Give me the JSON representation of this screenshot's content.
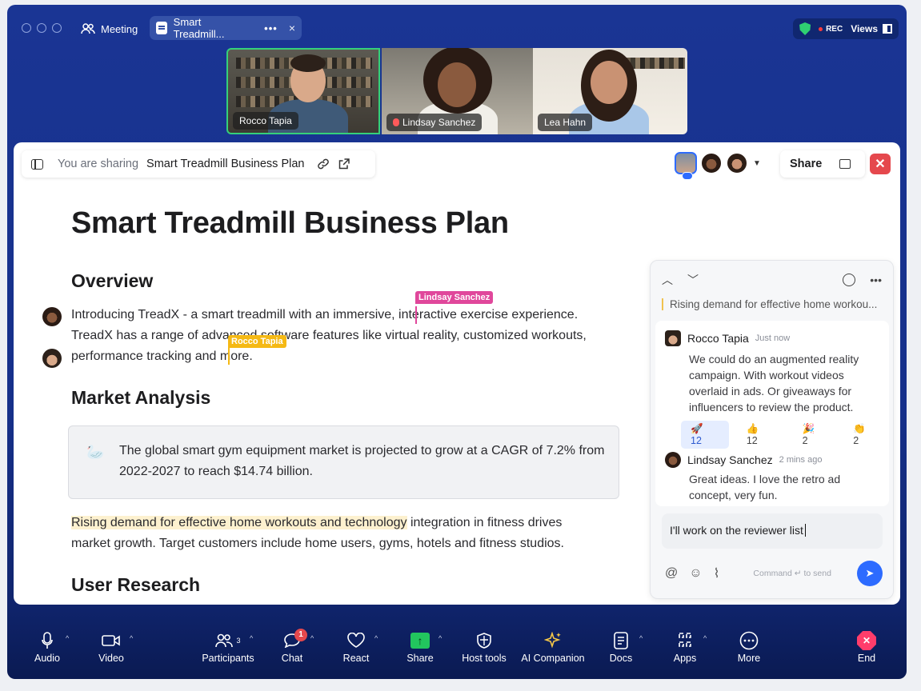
{
  "titlebar": {
    "meeting_label": "Meeting",
    "doc_tab_label": "Smart Treadmill...",
    "doc_tab_more": "•••",
    "doc_tab_close": "×",
    "rec_label": "REC",
    "views_label": "Views"
  },
  "participants_video": [
    {
      "name": "Rocco Tapia",
      "muted": false
    },
    {
      "name": "Lindsay Sanchez",
      "muted": true
    },
    {
      "name": "Lea Hahn",
      "muted": false
    }
  ],
  "sharebar": {
    "prefix": "You are sharing",
    "doc_name": "Smart Treadmill Business Plan"
  },
  "share_button": {
    "label": "Share"
  },
  "document": {
    "title": "Smart Treadmill Business Plan",
    "overview_heading": "Overview",
    "overview_line1": "Introducing TreadX - a smart treadmill with an immersive, interactive exercise experience.",
    "overview_line2": "TreadX has a range of advanced software features like virtual reality, customized workouts,",
    "overview_line3": "performance tracking and more.",
    "market_heading": "Market Analysis",
    "callout_emoji": "🦢",
    "callout_text": "The global smart gym equipment market is projected to grow at a CAGR of 7.2% from 2022-2027 to reach $14.74 billion.",
    "market_highlight": "Rising demand for effective home workouts and technology",
    "market_rest1": " integration in fitness drives",
    "market_line2": "market growth. Target customers include home users, gyms, hotels and fitness studios.",
    "research_heading": "User Research"
  },
  "cursors": {
    "lindsay": "Lindsay Sanchez",
    "rocco": "Rocco Tapia",
    "lindsay_color": "#e0479b",
    "rocco_color": "#f5b914"
  },
  "comments": {
    "quote": "Rising demand for effective home workou...",
    "items": [
      {
        "author": "Rocco Tapia",
        "time": "Just now",
        "text": "We could do an augmented reality campaign. With workout videos overlaid in ads. Or giveaways for influencers to review the product."
      },
      {
        "author": "Lindsay Sanchez",
        "time": "2 mins ago",
        "text": "Great ideas. I love the retro ad concept, very fun."
      }
    ],
    "reactions": [
      {
        "emoji": "🚀",
        "count": "12"
      },
      {
        "emoji": "👍",
        "count": "12"
      },
      {
        "emoji": "🎉",
        "count": "2"
      },
      {
        "emoji": "👏",
        "count": "2"
      }
    ],
    "reply_value": "I'll work on the reviewer list",
    "send_hint_cmd": "Command",
    "send_hint_key": "↵",
    "send_hint_rest": "to send"
  },
  "toolbar": {
    "audio": "Audio",
    "video": "Video",
    "participants": "Participants",
    "participants_count": "3",
    "chat": "Chat",
    "chat_badge": "1",
    "react": "React",
    "share": "Share",
    "host_tools": "Host tools",
    "ai_companion": "AI Companion",
    "docs": "Docs",
    "apps": "Apps",
    "more": "More",
    "end": "End"
  },
  "colors": {
    "window_bg": "#1a3594",
    "accent": "#2d6bff",
    "active_speaker": "#35d07a",
    "close_red": "#e5484d",
    "highlight": "#fdf1cf"
  }
}
